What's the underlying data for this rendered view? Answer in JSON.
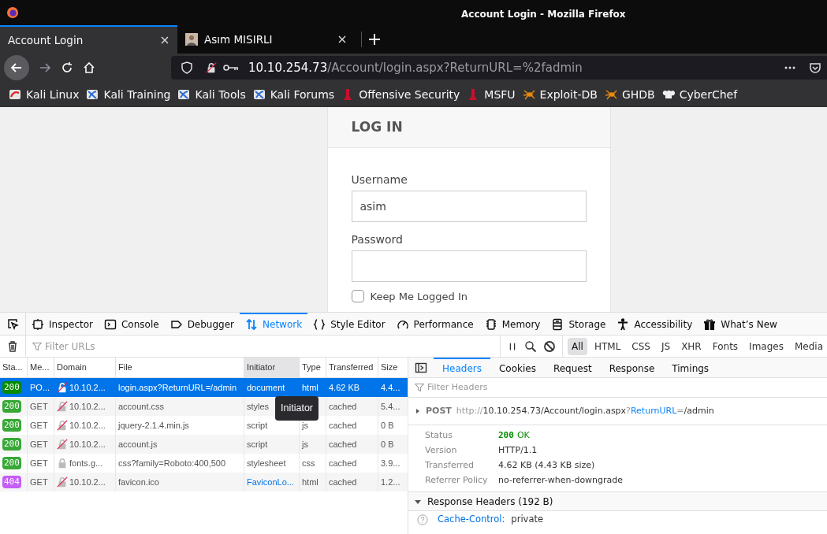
{
  "window": {
    "title": "Account Login - Mozilla Firefox"
  },
  "tabs": [
    {
      "label": "Account Login",
      "selected": true,
      "favicon": false
    },
    {
      "label": "Asım MISIRLI",
      "selected": false,
      "favicon": true
    }
  ],
  "address": {
    "host": "10.10.254.73",
    "path": "/Account/login.aspx?ReturnURL=%2fadmin"
  },
  "bookmarks": [
    {
      "label": "Kali Linux",
      "kind": "kali-red"
    },
    {
      "label": "Kali Training",
      "kind": "kali"
    },
    {
      "label": "Kali Tools",
      "kind": "kali"
    },
    {
      "label": "Kali Forums",
      "kind": "kali"
    },
    {
      "label": "Offensive Security",
      "kind": "offsec"
    },
    {
      "label": "MSFU",
      "kind": "offsec"
    },
    {
      "label": "Exploit-DB",
      "kind": "spider"
    },
    {
      "label": "GHDB",
      "kind": "spider"
    },
    {
      "label": "CyberChef",
      "kind": "chef"
    }
  ],
  "login": {
    "heading": "LOG IN",
    "fields": [
      {
        "label": "Username",
        "value": "asim"
      },
      {
        "label": "Password"
      }
    ],
    "remember": {
      "label": "Keep Me Logged In",
      "checked": false
    }
  },
  "devtools": {
    "tools": [
      {
        "label": "Inspector",
        "selected": false
      },
      {
        "label": "Console",
        "selected": false
      },
      {
        "label": "Debugger",
        "selected": false
      },
      {
        "label": "Network",
        "selected": true
      },
      {
        "label": "Style Editor",
        "selected": false
      },
      {
        "label": "Performance",
        "selected": false
      },
      {
        "label": "Memory",
        "selected": false
      },
      {
        "label": "Storage",
        "selected": false
      },
      {
        "label": "Accessibility",
        "selected": false
      },
      {
        "label": "What’s New",
        "selected": false
      }
    ],
    "filter": {
      "placeholder": "Filter URLs"
    },
    "type_filters": [
      {
        "label": "All",
        "selected": true
      },
      {
        "label": "HTML",
        "selected": false
      },
      {
        "label": "CSS",
        "selected": false
      },
      {
        "label": "JS",
        "selected": false
      },
      {
        "label": "XHR",
        "selected": false
      },
      {
        "label": "Fonts",
        "selected": false
      },
      {
        "label": "Images",
        "selected": false
      },
      {
        "label": "Media",
        "selected": false
      }
    ],
    "columns": [
      {
        "label": "Sta...",
        "sorted": false
      },
      {
        "label": "Me...",
        "sorted": false
      },
      {
        "label": "Domain",
        "sorted": false
      },
      {
        "label": "File",
        "sorted": false
      },
      {
        "label": "Initiator",
        "sorted": true
      },
      {
        "label": "Type",
        "sorted": false
      },
      {
        "label": "Transferred",
        "sorted": false
      },
      {
        "label": "Size",
        "sorted": false
      }
    ],
    "rows": [
      {
        "status": "200",
        "color": "#058b00",
        "method": "PO...",
        "secure": false,
        "domain": "10.10.2...",
        "file": "login.aspx?ReturnURL=/admin",
        "initiator": "document",
        "initiator_link": false,
        "type": "html",
        "transferred": "4.62 KB",
        "size": "4.4...",
        "selected": true
      },
      {
        "status": "200",
        "color": "#38a836",
        "method": "GET",
        "secure": false,
        "domain": "10.10.2...",
        "file": "account.css",
        "initiator": "styles",
        "initiator_link": false,
        "transferred": "cached",
        "size": "5.4...",
        "selected": false
      },
      {
        "status": "200",
        "color": "#38a836",
        "method": "GET",
        "secure": false,
        "domain": "10.10.2...",
        "file": "jquery-2.1.4.min.js",
        "initiator": "script",
        "initiator_link": false,
        "type": "js",
        "transferred": "cached",
        "size": "0 B",
        "selected": false
      },
      {
        "status": "200",
        "color": "#38a836",
        "method": "GET",
        "secure": false,
        "domain": "10.10.2...",
        "file": "account.js",
        "initiator": "script",
        "initiator_link": false,
        "type": "js",
        "transferred": "cached",
        "size": "0 B",
        "selected": false
      },
      {
        "status": "200",
        "color": "#38a836",
        "method": "GET",
        "secure": true,
        "domain": "fonts.g...",
        "file": "css?family=Roboto:400,500",
        "initiator": "stylesheet",
        "initiator_link": false,
        "type": "css",
        "transferred": "cached",
        "size": "3.9...",
        "selected": false
      },
      {
        "status": "404",
        "color": "#c45ef7",
        "method": "GET",
        "secure": false,
        "domain": "10.10.2...",
        "file": "favicon.ico",
        "initiator": "FaviconLo...",
        "initiator_link": true,
        "type": "html",
        "transferred": "cached",
        "size": "1.2...",
        "selected": false
      }
    ],
    "tooltip": "Initiator",
    "detail": {
      "tabs": [
        {
          "label": "Headers",
          "selected": true
        },
        {
          "label": "Cookies",
          "selected": false
        },
        {
          "label": "Request",
          "selected": false
        },
        {
          "label": "Response",
          "selected": false
        },
        {
          "label": "Timings",
          "selected": false
        }
      ],
      "filter": {
        "placeholder": "Filter Headers"
      },
      "request": {
        "method": "POST",
        "url": [
          {
            "text": "http://",
            "kind": "dim"
          },
          {
            "text": "10.10.254.73/Account/login.aspx",
            "kind": "plain"
          },
          {
            "text": "?",
            "kind": "dim"
          },
          {
            "text": "ReturnURL",
            "kind": "key"
          },
          {
            "text": "=",
            "kind": "dim"
          },
          {
            "text": "/admin",
            "kind": "plain"
          }
        ]
      },
      "summary": [
        {
          "label": "Status",
          "value": "OK",
          "code": "200"
        },
        {
          "label": "Version",
          "value": "HTTP/1.1"
        },
        {
          "label": "Transferred",
          "value": "4.62 KB (4.43 KB size)"
        },
        {
          "label": "Referrer Policy",
          "value": "no-referrer-when-downgrade"
        }
      ],
      "response_headers": {
        "title": "Response Headers (192 B)",
        "expanded": true,
        "items": [
          {
            "name": "Cache-Control:",
            "value": "private"
          }
        ]
      }
    }
  }
}
